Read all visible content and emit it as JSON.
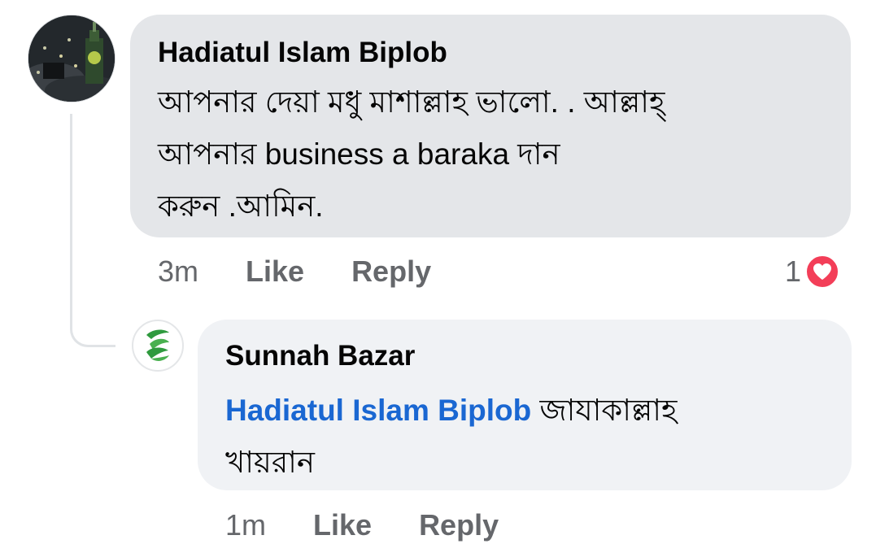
{
  "comment": {
    "author": "Hadiatul Islam Biplob",
    "text": "আপনার দেয়া মধু মাশাল্লাহ ভালো. . আল্লাহ্\nআপনার business a baraka দান\nকরুন .আমিন.",
    "time": "3m",
    "like_label": "Like",
    "reply_label": "Reply",
    "reaction_count": "1",
    "reaction_icon": "heart-icon",
    "reaction_color": "#f33e58"
  },
  "reply": {
    "author": "Sunnah Bazar",
    "mention": "Hadiatul Islam Biplob",
    "text": " জাযাকাল্লাহ\nখায়রান",
    "time": "1m",
    "like_label": "Like",
    "reply_label": "Reply",
    "mention_color": "#1a67d2"
  }
}
